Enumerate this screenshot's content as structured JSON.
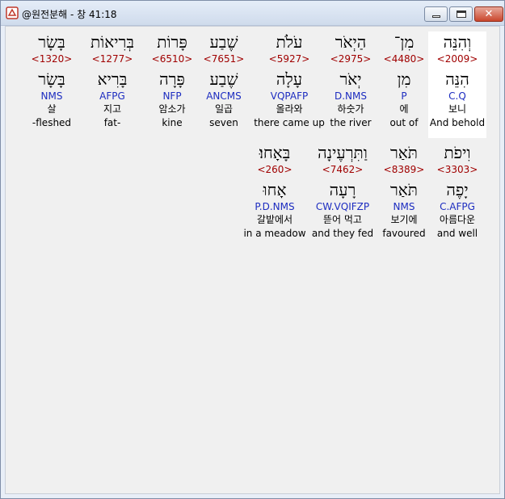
{
  "window": {
    "title": "@원전분해 - 창 41:18",
    "close_label": "✕"
  },
  "rows": [
    [
      {
        "heb": "וְהִנֵּה",
        "strong": "<2009>",
        "lemma": "הִנֵּה",
        "parse": "C.Q",
        "kor": "보니",
        "eng": "And behold",
        "selected": true
      },
      {
        "heb": "מִן־",
        "strong": "<4480>",
        "lemma": "מִן",
        "parse": "P",
        "kor": "에",
        "eng": "out of"
      },
      {
        "heb": "הַיְאֹר",
        "strong": "<2975>",
        "lemma": "יְאֹר",
        "parse": "D.NMS",
        "kor": "하숫가",
        "eng": "the river"
      },
      {
        "heb": "עֹלֹת",
        "strong": "<5927>",
        "lemma": "עָלָה",
        "parse": "VQPAFP",
        "kor": "올라와",
        "eng": "there came up"
      },
      {
        "heb": "שֶׁבַע",
        "strong": "<7651>",
        "lemma": "שֶׁבַע",
        "parse": "ANCMS",
        "kor": "일곱",
        "eng": "seven"
      },
      {
        "heb": "פָּרוֹת",
        "strong": "<6510>",
        "lemma": "פָּרָה",
        "parse": "NFP",
        "kor": "암소가",
        "eng": "kine"
      },
      {
        "heb": "בְּרִיאוֹת",
        "strong": "<1277>",
        "lemma": "בָּרִיא",
        "parse": "AFPG",
        "kor": "지고",
        "eng": "fat-"
      },
      {
        "heb": "בָּשָׂר",
        "strong": "<1320>",
        "lemma": "בָּשָׂר",
        "parse": "NMS",
        "kor": "살",
        "eng": "-fleshed"
      }
    ],
    [
      {
        "heb": "וִיפֹת",
        "strong": "<3303>",
        "lemma": "יָפֶה",
        "parse": "C.AFPG",
        "kor": "아름다운",
        "eng": "and well"
      },
      {
        "heb": "תֹּאַר",
        "strong": "<8389>",
        "lemma": "תֹּאַר",
        "parse": "NMS",
        "kor": "보기에",
        "eng": "favoured"
      },
      {
        "heb": "וַתִּרְעֶינָה",
        "strong": "<7462>",
        "lemma": "רָעָה",
        "parse": "CW.VQIFZP",
        "kor": "뜯어 먹고",
        "eng": "and they fed"
      },
      {
        "heb": "בָּאָחוּ׃",
        "strong": "<260>",
        "lemma": "אָחוּ",
        "parse": "P.D.NMS",
        "kor": "갈밭에서",
        "eng": "in a meadow"
      }
    ]
  ]
}
